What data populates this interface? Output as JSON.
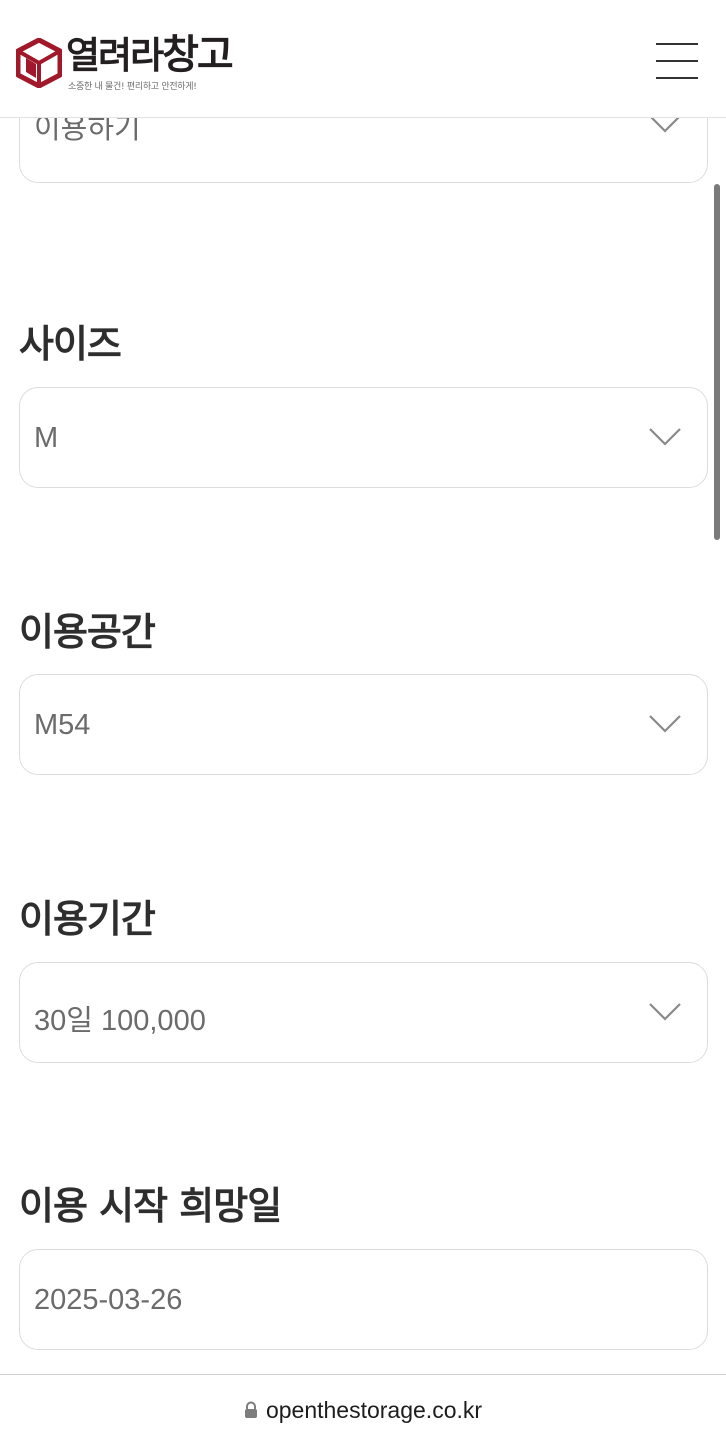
{
  "header": {
    "logo_name": "열려라",
    "logo_name_accent": "창고",
    "logo_tagline": "소중한 내 물건! 편리하고 안전하게!",
    "logo_color": "#a0182a"
  },
  "form": {
    "partial_field_value": "이용하기",
    "size": {
      "label": "사이즈",
      "value": "M"
    },
    "space": {
      "label": "이용공간",
      "value": "M54"
    },
    "period": {
      "label": "이용기간",
      "value": "30일 100,000"
    },
    "start_date": {
      "label": "이용 시작 희망일",
      "value": "2025-03-26"
    }
  },
  "browser": {
    "url": "openthestorage.co.kr",
    "icon": "lock-icon"
  }
}
